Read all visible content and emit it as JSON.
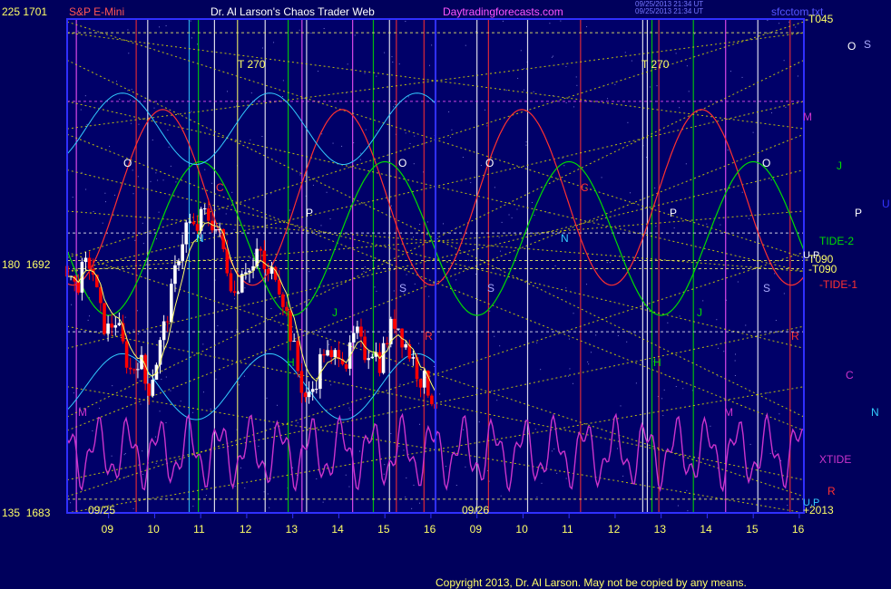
{
  "header": {
    "scale_top": "225  1701",
    "instrument": "S&P E-Mini",
    "title": "Dr. Al Larson's Chaos Trader Web",
    "site": "Daytradingforecasts.com",
    "timestamp_1": "09/25/2013 21:34 UT",
    "timestamp_2": "09/25/2013 21:34 UT",
    "file": "sfcctom.txt"
  },
  "footer": {
    "copyright": "Copyright 2013, Dr. Al Larson. May not be copied by any means."
  },
  "colors": {
    "background": "#00005c",
    "plot": "#000069",
    "price_up": "#ffffff",
    "price_down": "#ff0000",
    "tide": "#ff3030",
    "tide2": "#00dd00",
    "band": "#33ccff",
    "xtide": "#cc33cc",
    "grid": "#dddd00",
    "axis": "#3030ff"
  },
  "chart_data": {
    "type": "candlestick",
    "title": "Dr. Al Larson's Chaos Trader Web",
    "instrument": "S&P E-Mini",
    "y_scale": {
      "top": {
        "left": "225",
        "price": 1701
      },
      "middle": {
        "left": "180",
        "price": 1692
      },
      "bottom": {
        "left": "135",
        "price": 1683
      }
    },
    "ylim": [
      1683,
      1701
    ],
    "dates": [
      "09/25",
      "09/26"
    ],
    "x_ticks": [
      "09",
      "10",
      "11",
      "12",
      "13",
      "14",
      "15",
      "16",
      "09",
      "10",
      "11",
      "12",
      "13",
      "14",
      "15",
      "16"
    ],
    "x_range_hours": [
      8.1,
      24.1
    ],
    "price_range_hours": [
      8.1,
      16.1
    ],
    "price_sequence": [
      1692.0,
      1691.2,
      1691.8,
      1692.2,
      1690.4,
      1689.6,
      1690.1,
      1689.0,
      1688.1,
      1688.8,
      1687.4,
      1688.4,
      1689.6,
      1690.9,
      1692.6,
      1693.6,
      1693.2,
      1693.9,
      1693.7,
      1693.1,
      1692.0,
      1690.9,
      1692.2,
      1691.7,
      1692.6,
      1691.5,
      1691.9,
      1690.8,
      1689.4,
      1687.9,
      1687.0,
      1687.8,
      1689.0,
      1688.4,
      1689.1,
      1688.4,
      1689.6,
      1688.8,
      1689.1,
      1688.5,
      1689.4,
      1690.1,
      1689.3,
      1688.7,
      1688.0,
      1687.6,
      1687.0
    ],
    "series": [
      {
        "name": "TIDE-2",
        "color": "#00dd00"
      },
      {
        "name": "TIDE-1",
        "color": "#ff3030"
      },
      {
        "name": "XTIDE",
        "color": "#cc33cc"
      }
    ],
    "line_labels": [
      "-T045",
      "-T090",
      "-T090",
      "T 270",
      "T 270",
      "+2013"
    ],
    "left_markers": [
      "O",
      "N",
      "M",
      "P",
      "C",
      "R",
      "H",
      "J",
      "S",
      "U"
    ],
    "right_markers": [
      "O",
      "S",
      "M",
      "J",
      "U",
      "P",
      "TIDE-2",
      "-TIDE-1",
      "C",
      "N",
      "XTIDE",
      "R",
      "U.P",
      "U.P"
    ],
    "grid": true
  }
}
